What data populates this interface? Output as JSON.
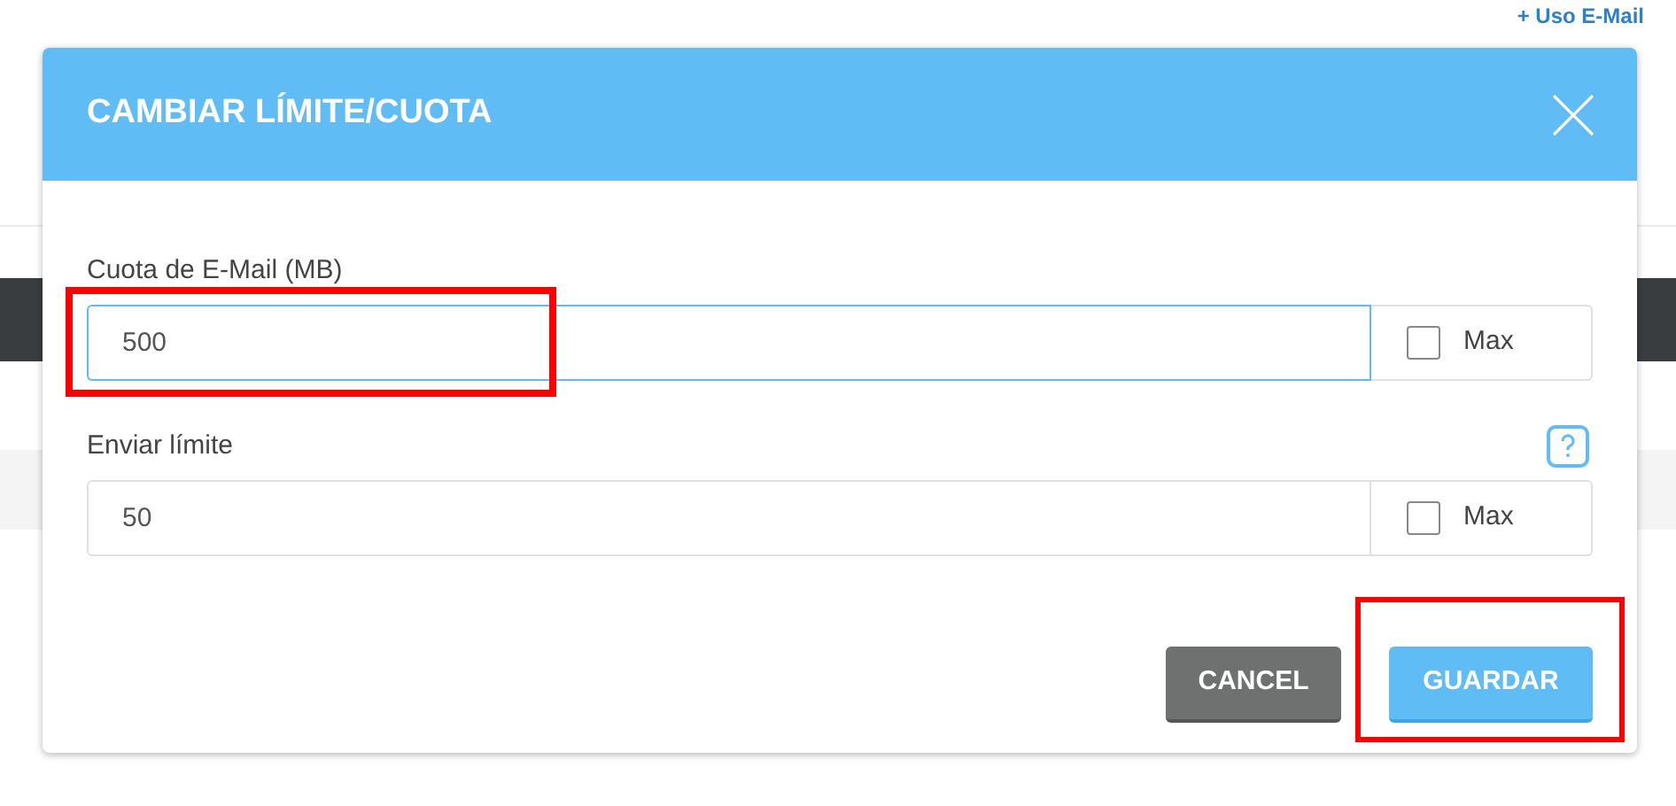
{
  "background": {
    "link": "+ Uso E-Mail"
  },
  "dialog": {
    "title": "CAMBIAR LÍMITE/CUOTA",
    "fields": [
      {
        "label": "Cuota de E-Mail (MB)",
        "value": "500",
        "focused": true,
        "highlighted": true,
        "help": false,
        "max": {
          "label": "Max",
          "checked": false
        }
      },
      {
        "label": "Enviar límite",
        "value": "50",
        "focused": false,
        "highlighted": false,
        "help": true,
        "max": {
          "label": "Max",
          "checked": false
        }
      }
    ],
    "buttons": [
      {
        "kind": "cancel",
        "label": "CANCEL",
        "highlighted": false
      },
      {
        "kind": "primary",
        "label": "GUARDAR",
        "highlighted": true
      }
    ]
  }
}
